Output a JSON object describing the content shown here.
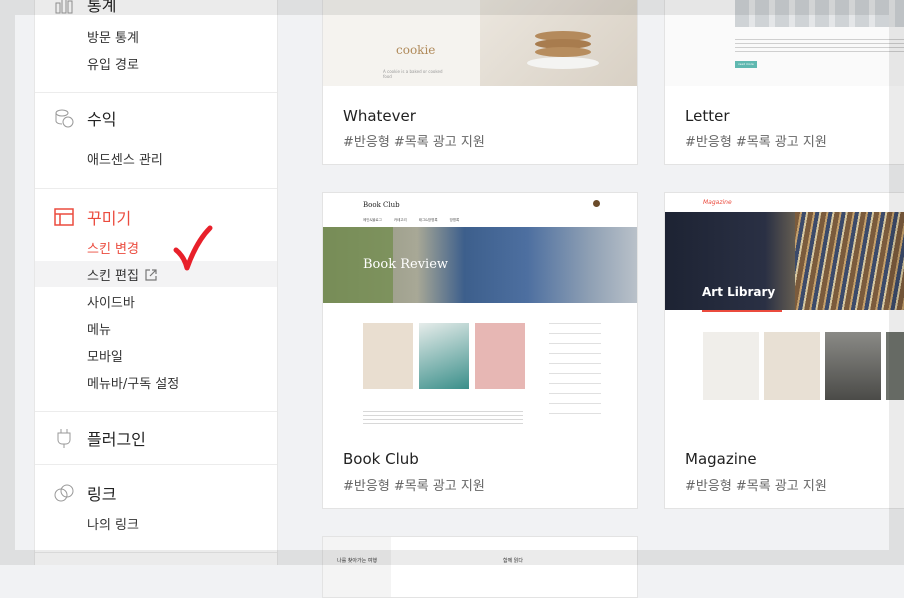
{
  "sidebar": {
    "stats": {
      "title": "통계",
      "items": [
        "방문 통계",
        "유입 경로"
      ]
    },
    "revenue": {
      "title": "수익",
      "items": [
        "애드센스 관리"
      ]
    },
    "decorate": {
      "title": "꾸미기",
      "items": [
        "스킨 변경",
        "스킨 편집",
        "사이드바",
        "메뉴",
        "모바일",
        "메뉴바/구독 설정"
      ]
    },
    "plugin": {
      "title": "플러그인"
    },
    "link": {
      "title": "링크",
      "items": [
        "나의 링크"
      ]
    }
  },
  "cards": [
    {
      "name": "Whatever",
      "tags": "#반응형   #목록 광고 지원",
      "thumb_text": "cookie",
      "thumb_caption": "A cookie is a baked or cooked food"
    },
    {
      "name": "Letter",
      "tags": "#반응형   #목록 광고 지원",
      "thumb_text": "read more"
    },
    {
      "name": "Book Club",
      "tags": "#반응형   #목록 광고 지원",
      "thumb_logo": "Book Club",
      "thumb_banner": "Book Review",
      "thumb_nav": [
        "메인&블로그",
        "카테고리",
        "태그&방명록",
        "방명록"
      ]
    },
    {
      "name": "Magazine",
      "tags": "#반응형   #목록 광고 지원",
      "thumb_logo": "Magazine",
      "thumb_banner": "Art Library"
    },
    {
      "name": "",
      "tags": "",
      "thumb_left": "나를 찾아가는 여행",
      "thumb_right": "함께 읽다"
    }
  ],
  "colors": {
    "accent": "#eb4b3e",
    "check": "#e8202a"
  }
}
